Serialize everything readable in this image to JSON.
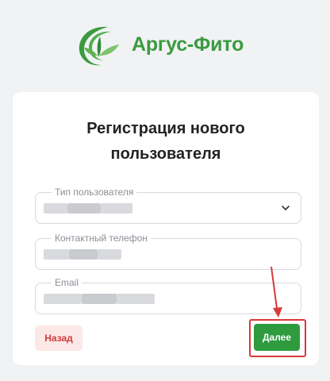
{
  "brand": {
    "name": "Аргус-Фито",
    "color": "#3a9b3f"
  },
  "form": {
    "title_line1": "Регистрация нового",
    "title_line2": "пользователя",
    "fields": [
      {
        "label": "Тип пользователя",
        "type": "select"
      },
      {
        "label": "Контактный телефон",
        "type": "text"
      },
      {
        "label": "Email",
        "type": "text"
      }
    ],
    "back_label": "Назад",
    "next_label": "Далее"
  },
  "annotation": {
    "color": "#d8393a"
  }
}
